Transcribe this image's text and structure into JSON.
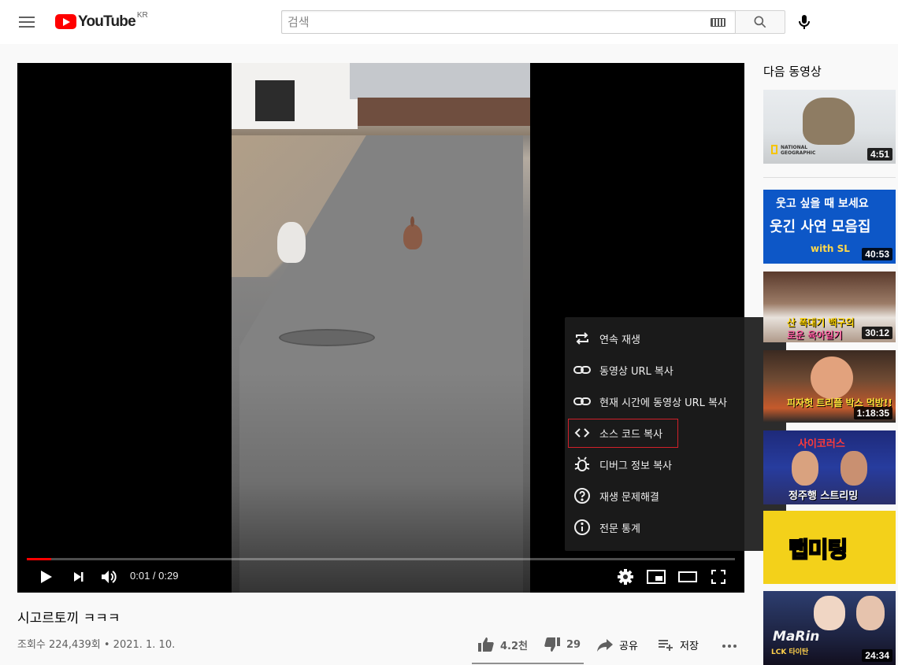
{
  "header": {
    "logo_text": "YouTube",
    "country_code": "KR",
    "search_placeholder": "검색"
  },
  "player": {
    "current_time": "0:01",
    "separator": " / ",
    "duration": "0:29",
    "progress_fraction": 0.0345
  },
  "settings_menu": {
    "items": [
      {
        "label": "연속 재생",
        "icon": "loop-icon"
      },
      {
        "label": "동영상 URL 복사",
        "icon": "link-icon"
      },
      {
        "label": "현재 시간에 동영상 URL 복사",
        "icon": "link-icon"
      },
      {
        "label": "소스 코드 복사",
        "icon": "code-icon",
        "highlighted": true
      },
      {
        "label": "디버그 정보 복사",
        "icon": "bug-icon"
      },
      {
        "label": "재생 문제해결",
        "icon": "help-icon"
      },
      {
        "label": "전문 통계",
        "icon": "info-icon"
      }
    ]
  },
  "video": {
    "title": "시고르토끼 ㅋㅋㅋ",
    "views": "조회수 224,439회",
    "dot": " • ",
    "date": "2021. 1. 10.",
    "likes": "4.2천",
    "dislikes": "29",
    "share_label": "공유",
    "save_label": "저장"
  },
  "sidebar": {
    "up_next_label": "다음 동영상",
    "thumbnails": [
      {
        "duration": "4:51",
        "overlay": [
          "NATIONAL",
          "GEOGRAPHIC"
        ]
      },
      {
        "duration": "40:53",
        "overlay": [
          "웃고 싶을 때 보세요",
          "웃긴 사연 모음집",
          "with SL"
        ]
      },
      {
        "duration": "30:12",
        "overlay": [
          "산 폭대기 백구의",
          "로운 육아일기"
        ]
      },
      {
        "duration": "1:18:35",
        "overlay": [
          "피자헛 트리플 박스 먹방!!"
        ]
      },
      {
        "duration": "",
        "overlay": [
          "사이코러스",
          "정주행 스트리밍"
        ]
      },
      {
        "duration": "",
        "overlay": [
          "랩미팅"
        ]
      },
      {
        "duration": "24:34",
        "overlay": [
          "MaRin",
          "LCK 타이탄"
        ]
      }
    ]
  },
  "colors": {
    "brand_red": "#ff0000",
    "highlight_border": "#d3202a",
    "menu_bg": "#1c1c1c"
  }
}
